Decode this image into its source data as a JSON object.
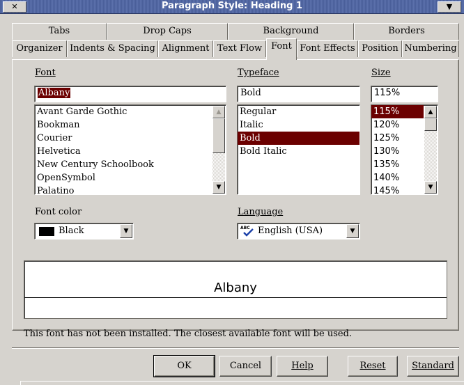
{
  "window": {
    "title": "Paragraph Style: Heading 1",
    "close_glyph": "✕",
    "menu_glyph": "▼"
  },
  "tabs_row1": [
    "Tabs",
    "Drop Caps",
    "Background",
    "Borders"
  ],
  "tabs_row2": [
    "Organizer",
    "Indents & Spacing",
    "Alignment",
    "Text Flow",
    "Font",
    "Font Effects",
    "Position",
    "Numbering"
  ],
  "active_tab": "Font",
  "font": {
    "label": "Font",
    "value": "Albany",
    "items": [
      "Avant Garde Gothic",
      "Bookman",
      "Courier",
      "Helvetica",
      "New Century Schoolbook",
      "OpenSymbol",
      "Palatino"
    ]
  },
  "typeface": {
    "label": "Typeface",
    "value": "Bold",
    "items": [
      "Regular",
      "Italic",
      "Bold",
      "Bold Italic"
    ],
    "selected_index": 2
  },
  "size": {
    "label": "Size",
    "value": "115%",
    "items": [
      "115%",
      "120%",
      "125%",
      "130%",
      "135%",
      "140%",
      "145%"
    ],
    "selected_index": 0
  },
  "font_color": {
    "label": "Font color",
    "value": "Black",
    "swatch": "#000000"
  },
  "language": {
    "label": "Language",
    "value": "English (USA)",
    "icon_text": "ABC"
  },
  "preview": {
    "text": "Albany"
  },
  "status": "This font has not been installed. The closest available font will be used.",
  "buttons": {
    "ok": "OK",
    "cancel": "Cancel",
    "help": "Help",
    "reset": "Reset",
    "standard": "Standard"
  },
  "colors": {
    "selection": "#6b0000",
    "titlebar": "#4a5f9a",
    "face": "#d6d3ce"
  }
}
